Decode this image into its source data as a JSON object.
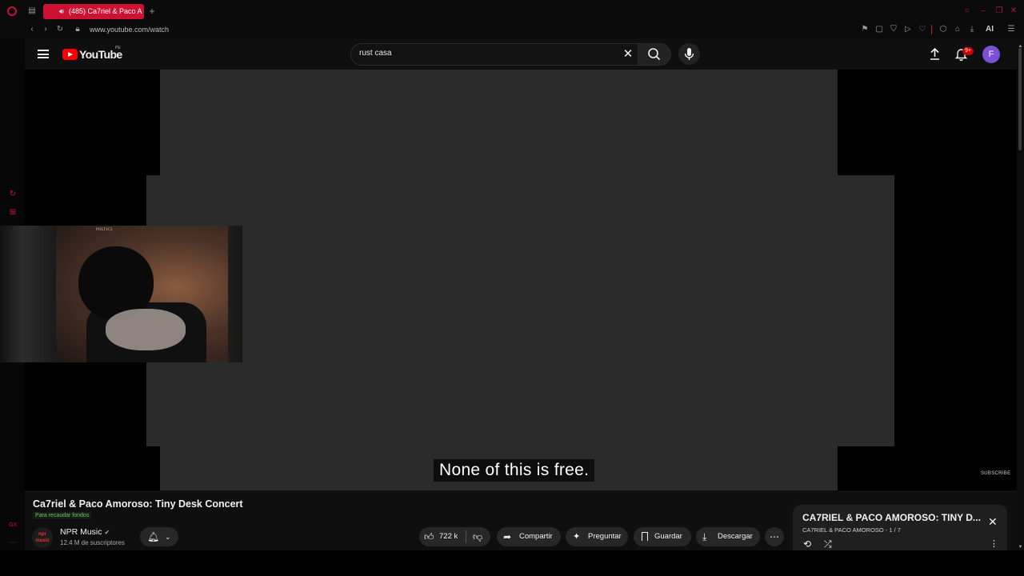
{
  "browser": {
    "tab_title": "(485) Ca7riel & Paco A",
    "new_tab_label": "+",
    "url": "www.youtube.com/watch",
    "ai_label": "AI"
  },
  "youtube": {
    "logo_text": "YouTube",
    "logo_region": "PE",
    "search_query": "rust casa",
    "notification_count": "9+",
    "account_initial": "F"
  },
  "video": {
    "caption": "None of this is free.",
    "watermark": "SUBSCRIBE"
  },
  "webcam": {
    "poster_text": "POLT1C3"
  },
  "info": {
    "title": "Ca7riel & Paco Amoroso: Tiny Desk Concert",
    "fundraiser": "Para recaudar fondos",
    "channel_name": "NPR Music",
    "channel_logo": "npr music",
    "subscribers": "12.4 M de suscriptores",
    "likes": "722 k",
    "share": "Compartir",
    "ask": "Preguntar",
    "save": "Guardar",
    "download": "Descargar"
  },
  "playlist": {
    "title": "CA7RIEL & PACO AMOROSO: TINY D...",
    "subtitle": "CA7RIEL & PACO AMOROSO - 1 / 7"
  },
  "colors": {
    "opera_red": "#cc1133",
    "youtube_red": "#ff0000",
    "video_gray": "#2b2b2b",
    "avatar_purple": "#7b4fd6"
  }
}
